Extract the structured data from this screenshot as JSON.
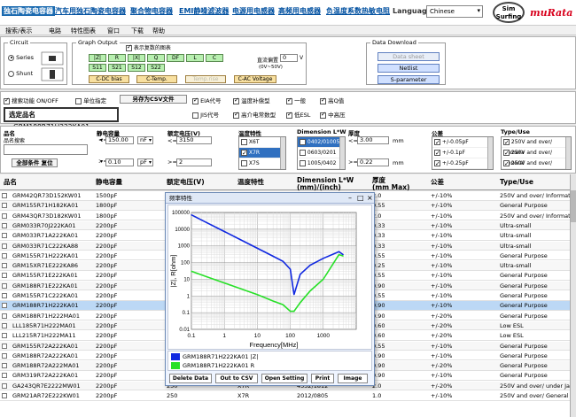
{
  "topnav": {
    "links": [
      "独石陶瓷电容器",
      "汽车用独石陶瓷电容器",
      "聚合物电容器",
      "EMI静噪滤波器",
      "电源用电感器",
      "高频用电感器",
      "负温度系数热敏电阻"
    ],
    "language_label": "Language",
    "language_value": "Chinese",
    "logo_text": "Sim Surfing",
    "brand": "muRata"
  },
  "menu": [
    "搜索/表示",
    "电路",
    "特性图表",
    "窗口",
    "下载",
    "帮助"
  ],
  "circuit": {
    "legend": "Circuit",
    "series": "Series",
    "shunt": "Shunt"
  },
  "graph_output": {
    "legend": "Graph Output",
    "show_checkbox": "表示复数的图表",
    "buttons": [
      "|Z|",
      "R",
      "|X|",
      "Q",
      "DF",
      "L",
      "C",
      "S11",
      "S21",
      "S12",
      "S22"
    ],
    "cdc_bias": "C-DC bias",
    "ctemp": "C-Temp.",
    "temp_rise": "Temp.rise",
    "cac_voltage": "C-AC Voltage",
    "dc_bias_label": "直流偏置",
    "dc_bias_value": "0",
    "dc_bias_unit": "V",
    "dc_bias_range": "(0V~50V)"
  },
  "data_download": {
    "legend": "Data Download",
    "data_sheet": "Data sheet",
    "netlist": "Netlist",
    "s_parameter": "S-parameter"
  },
  "options": {
    "search_toggle": "搜索功能 ON/OFF",
    "unit_spec": "单位指定",
    "save_csv": "另存为CSV文件",
    "eia": "EIA代号",
    "jis": "JIS代号",
    "temp_comp": "温度补偿型",
    "high_dielectric": "高介电常数型",
    "general": "一般",
    "low_esl": "低ESL",
    "high_q": "高Q值",
    "mid_high_voltage": "中高压"
  },
  "selected_name_label": "选定品名",
  "selected_name_value": "GRM188R71H222KA01",
  "filters": {
    "part_label": "品名",
    "part_search": "品名搜索",
    "reset": "全部条件 复位",
    "capacitance_label": "静电容量",
    "cap_op1": "<=",
    "cap_val1": "150.00",
    "cap_unit1": "nF",
    "cap_op2": ">=",
    "cap_val2": "0.10",
    "cap_unit2": "pF",
    "voltage_label": "额定电压(V)",
    "volt_op1": "<=",
    "volt_val1": "3150",
    "volt_op2": ">=",
    "volt_val2": "2",
    "temp_label": "温度特性",
    "temp_items": [
      "X6T",
      "X7R",
      "X7S"
    ],
    "dim_label": "Dimension L*W",
    "dim_items": [
      "0402/01005",
      "0603/0201",
      "1005/0402"
    ],
    "thick_label": "厚度",
    "thick_op1": "<=",
    "thick_val1": "3.00",
    "thick_unit": "mm",
    "thick_op2": ">=",
    "thick_val2": "0.22",
    "tol_label": "公差",
    "tol_items": [
      "+/-0.05pF",
      "+/-0.1pF",
      "+/-0.25pF"
    ],
    "type_label": "Type/Use",
    "type_items": [
      "250V and over/ Camera",
      "250V and over/ General",
      "250V and over/ Informat"
    ]
  },
  "table": {
    "headers": [
      "品名",
      "静电容量",
      "额定电压(V)",
      "温度特性",
      "Dimension L*W\n(mm)/(inch)",
      "厚度\n(mm Max)",
      "公差",
      "Type/Use"
    ],
    "rows": [
      [
        "GRM42QR73D152KW01",
        "1500pF",
        "2000",
        "X7R",
        "4532/1812",
        "2.0",
        "+/-10%",
        "250V and over/ Informat"
      ],
      [
        "GRM155R71H182KA01",
        "1800pF",
        "50",
        "X7R",
        "1005/0402",
        "0.55",
        "+/-10%",
        "General Purpose"
      ],
      [
        "GRM43QR73D182KW01",
        "1800pF",
        "2000",
        "X7R",
        "4532/1812",
        "2.0",
        "+/-10%",
        "250V and over/ Informat"
      ],
      [
        "GRM033R70J222KA01",
        "2200pF",
        "6.3",
        "X7R",
        "0603/0201",
        "0.33",
        "+/-10%",
        "Ultra-small"
      ],
      [
        "GRM033R71A222KA01",
        "2200pF",
        "10",
        "X7R",
        "0603/0201",
        "0.33",
        "+/-10%",
        "Ultra-small"
      ],
      [
        "GRM033R71C222KA88",
        "2200pF",
        "16",
        "X7R",
        "0603/0201",
        "0.33",
        "+/-10%",
        "Ultra-small"
      ],
      [
        "GRM155R71H222KA01",
        "2200pF",
        "50",
        "X7R",
        "1005/0402",
        "0.55",
        "+/-10%",
        "General Purpose"
      ],
      [
        "GRM15XR71E222KA86",
        "2200pF",
        "25",
        "X7R",
        "1005/0402",
        "0.25",
        "+/-10%",
        "Ultra-small"
      ],
      [
        "GRM155R71E222KA01",
        "2200pF",
        "25",
        "X7R",
        "1005/0402",
        "0.55",
        "+/-10%",
        "General Purpose"
      ],
      [
        "GRM188R71E222KA01",
        "2200pF",
        "25",
        "X7R",
        "1608/0603",
        "0.90",
        "+/-10%",
        "General Purpose"
      ],
      [
        "GRM155R71C222KA01",
        "2200pF",
        "16",
        "X7R",
        "1005/0402",
        "0.55",
        "+/-10%",
        "General Purpose"
      ],
      [
        "GRM188R71H222KA01",
        "2200pF",
        "50",
        "X7R",
        "1608/0603",
        "0.90",
        "+/-10%",
        "General Purpose"
      ],
      [
        "GRM188R71H222MA01",
        "2200pF",
        "50",
        "X7R",
        "1608/0603",
        "0.90",
        "+/-20%",
        "General Purpose"
      ],
      [
        "LLL185R71H222MA01",
        "2200pF",
        "50",
        "X7R",
        "1608/0603",
        "0.60",
        "+/-20%",
        "Low ESL"
      ],
      [
        "LLL215R71H222MA11",
        "2200pF",
        "50",
        "X7R",
        "2012/0805",
        "0.60",
        "+/-20%",
        "Low ESL"
      ],
      [
        "GRM155R72A222KA01",
        "2200pF",
        "100",
        "X7R",
        "1005/0402",
        "0.55",
        "+/-10%",
        "General Purpose"
      ],
      [
        "GRM188R72A222KA01",
        "2200pF",
        "100",
        "X7R",
        "1608/0603",
        "0.90",
        "+/-10%",
        "General Purpose"
      ],
      [
        "GRM188R72A222MA01",
        "2200pF",
        "100",
        "X7R",
        "1608/0603",
        "0.90",
        "+/-20%",
        "General Purpose"
      ],
      [
        "GRM319R72A222KA01",
        "2200pF",
        "100",
        "X7R",
        "3216/1206",
        "0.90",
        "+/-10%",
        "General Purpose"
      ],
      [
        "GA243QR7E2222MW01",
        "2200pF",
        "250",
        "X7R",
        "4532/1812",
        "2.0",
        "+/-20%",
        "250V and over/ under Ja"
      ],
      [
        "GRM21AR72E222KW01",
        "2200pF",
        "250",
        "X7R",
        "2012/0805",
        "1.0",
        "+/-10%",
        "250V and over/ General"
      ]
    ]
  },
  "dialog": {
    "title": "频率特性",
    "x_axis_label": "Frequency[MHz]",
    "y_axis_label": "|Z|, R[ohm]",
    "legend1": "GRM188R71H222KA01 |Z|",
    "legend2": "GRM188R71H222KA01 R",
    "buttons": [
      "Delete Data",
      "Out to CSV",
      "Open Setting",
      "Print",
      "Image"
    ],
    "series_colors": [
      "#1028e0",
      "#28e028"
    ]
  },
  "chart_data": {
    "type": "line",
    "title": "",
    "xlabel": "Frequency[MHz]",
    "ylabel": "|Z|, R[ohm]",
    "x_scale": "log",
    "y_scale": "log",
    "xlim": [
      0.1,
      10000
    ],
    "ylim": [
      0.01,
      100000
    ],
    "x_ticks": [
      "0.1",
      "1",
      "10",
      "100",
      "1000"
    ],
    "y_ticks": [
      "0.01",
      "0.1",
      "1",
      "10",
      "100",
      "1000",
      "10000",
      "100000"
    ],
    "grid": true,
    "series": [
      {
        "name": "GRM188R71H222KA01 |Z|",
        "x": [
          0.1,
          0.3,
          1,
          3,
          10,
          30,
          60,
          100,
          130,
          200,
          400,
          1000,
          3000,
          4000
        ],
        "y": [
          72000,
          24000,
          7200,
          2400,
          720,
          240,
          120,
          40,
          1.2,
          20,
          70,
          180,
          450,
          300
        ]
      },
      {
        "name": "GRM188R71H222KA01 R",
        "x": [
          0.1,
          0.3,
          1,
          3,
          10,
          30,
          60,
          100,
          130,
          200,
          400,
          1000,
          3000,
          4000
        ],
        "y": [
          30,
          14,
          6,
          2.8,
          1.2,
          0.5,
          0.3,
          0.12,
          0.12,
          0.4,
          2,
          10,
          300,
          250
        ]
      }
    ]
  }
}
